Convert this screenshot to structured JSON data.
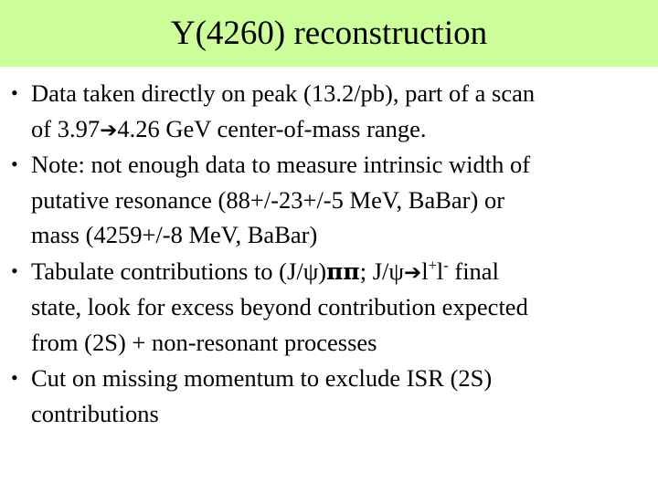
{
  "slide": {
    "title": "Y(4260) reconstruction",
    "title_band_color": "#ccff99",
    "background_color": "#ffffff",
    "text_color": "#000000",
    "bullet_marker": "•",
    "bullets": [
      {
        "id": "bullet-data-taken",
        "lines": [
          "Data taken directly on peak (13.2/pb), part of a scan",
          "of 3.97→4.26 GeV center-of-mass range."
        ],
        "text": "Data taken directly on peak (13.2/pb), part of a scan of 3.97→4.26 GeV center-of-mass range."
      },
      {
        "id": "bullet-note-width",
        "lines": [
          "Note: not enough data to measure intrinsic width of",
          "putative resonance (88+/-23+/-5 MeV, BaBar) or",
          "mass (4259+/-8 MeV, BaBar)"
        ],
        "text": "Note: not enough data to measure intrinsic width of putative resonance (88+/-23+/-5 MeV, BaBar) or mass (4259+/-8 MeV, BaBar)"
      },
      {
        "id": "bullet-tabulate",
        "lines": [
          "Tabulate contributions to (J/ψ)ππ; J/ψ→l+l- final",
          "state, look for excess beyond contribution expected",
          "from (2S) + non-resonant processes"
        ],
        "text": "Tabulate contributions to (J/ψ)ππ; J/ψ→l+l- final state, look for excess beyond contribution expected from (2S) + non-resonant processes"
      },
      {
        "id": "bullet-cut-missing",
        "lines": [
          "Cut on missing momentum to exclude ISR (2S)",
          "contributions"
        ],
        "text": "Cut on missing momentum to exclude ISR (2S) contributions"
      }
    ],
    "fragments": {
      "b1l1": "Data taken directly on peak (13.2/pb), part of a scan",
      "b1l2_a": "of 3.97",
      "b1l2_arrow": "➔",
      "b1l2_b": "4.26 GeV center-of-mass range.",
      "b2l1": "Note: not enough data to measure intrinsic width of",
      "b2l2": "putative resonance (88+/-23+/-5 MeV, BaBar) or",
      "b2l3": "mass (4259+/-8 MeV, BaBar)",
      "b3l1_a": "Tabulate contributions to (J/",
      "b3l1_psi1": "ψ",
      "b3l1_b": ")",
      "b3l1_pipi": "ππ",
      "b3l1_c": "; J/",
      "b3l1_psi2": "ψ",
      "b3l1_arrow": "➔",
      "b3l1_l1": "l",
      "b3l1_sup1": "+",
      "b3l1_l2": "l",
      "b3l1_sup2": "-",
      "b3l1_d": " final",
      "b3l2": "state, look for excess beyond contribution expected",
      "b3l3": "from (2S) + non-resonant processes",
      "b4l1": "Cut on missing momentum to exclude ISR (2S)",
      "b4l2": "contributions"
    }
  }
}
